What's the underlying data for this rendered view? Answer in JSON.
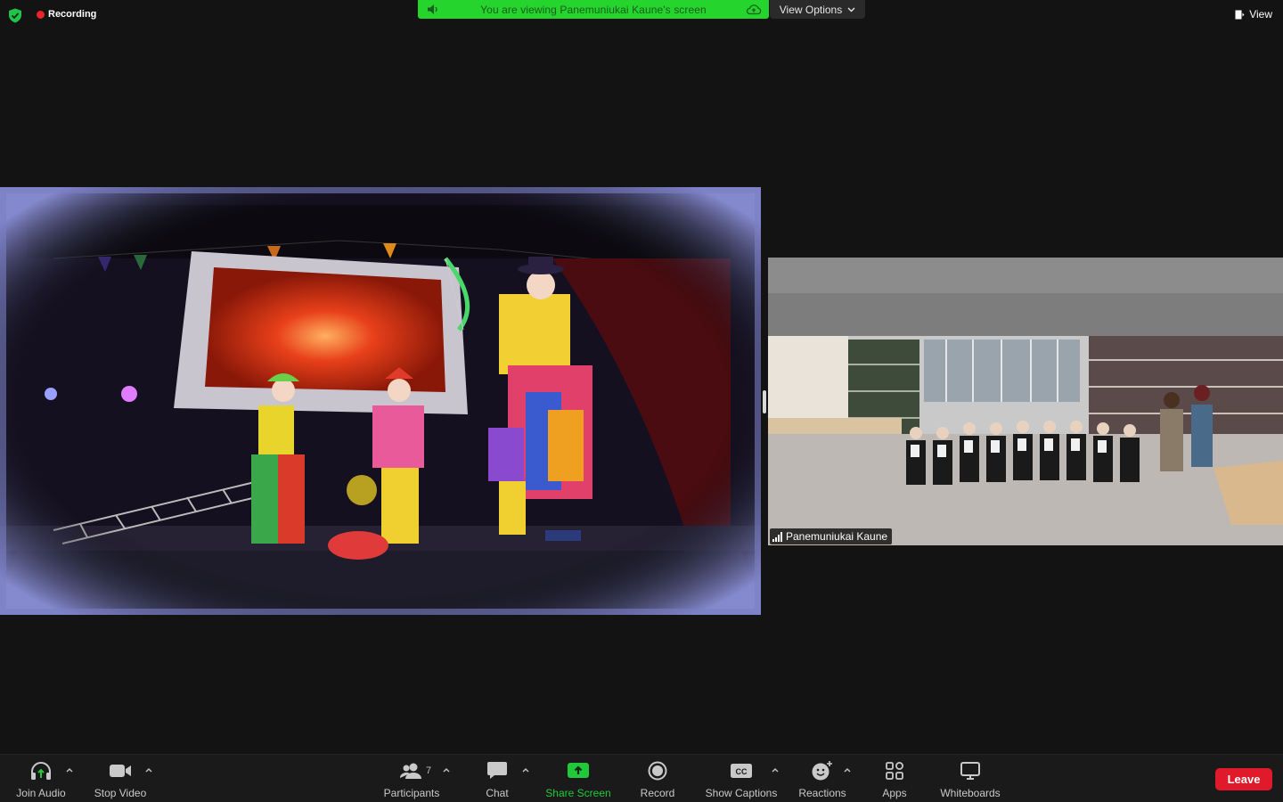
{
  "topbar": {
    "recording_label": "Recording",
    "banner_text": "You are viewing Panemuniukai Kaune's screen",
    "view_options_label": "View Options",
    "view_label": "View",
    "banner_color": "#25d42c",
    "record_dot_color": "#e8262a"
  },
  "video": {
    "participant_name": "Panemuniukai Kaune"
  },
  "toolbar": {
    "join_audio": "Join Audio",
    "stop_video": "Stop Video",
    "participants": "Participants",
    "participants_count": "7",
    "chat": "Chat",
    "share_screen": "Share Screen",
    "record": "Record",
    "show_captions": "Show Captions",
    "reactions": "Reactions",
    "apps": "Apps",
    "whiteboards": "Whiteboards",
    "leave": "Leave",
    "accent_green": "#21c93a",
    "leave_color": "#e0192b"
  }
}
